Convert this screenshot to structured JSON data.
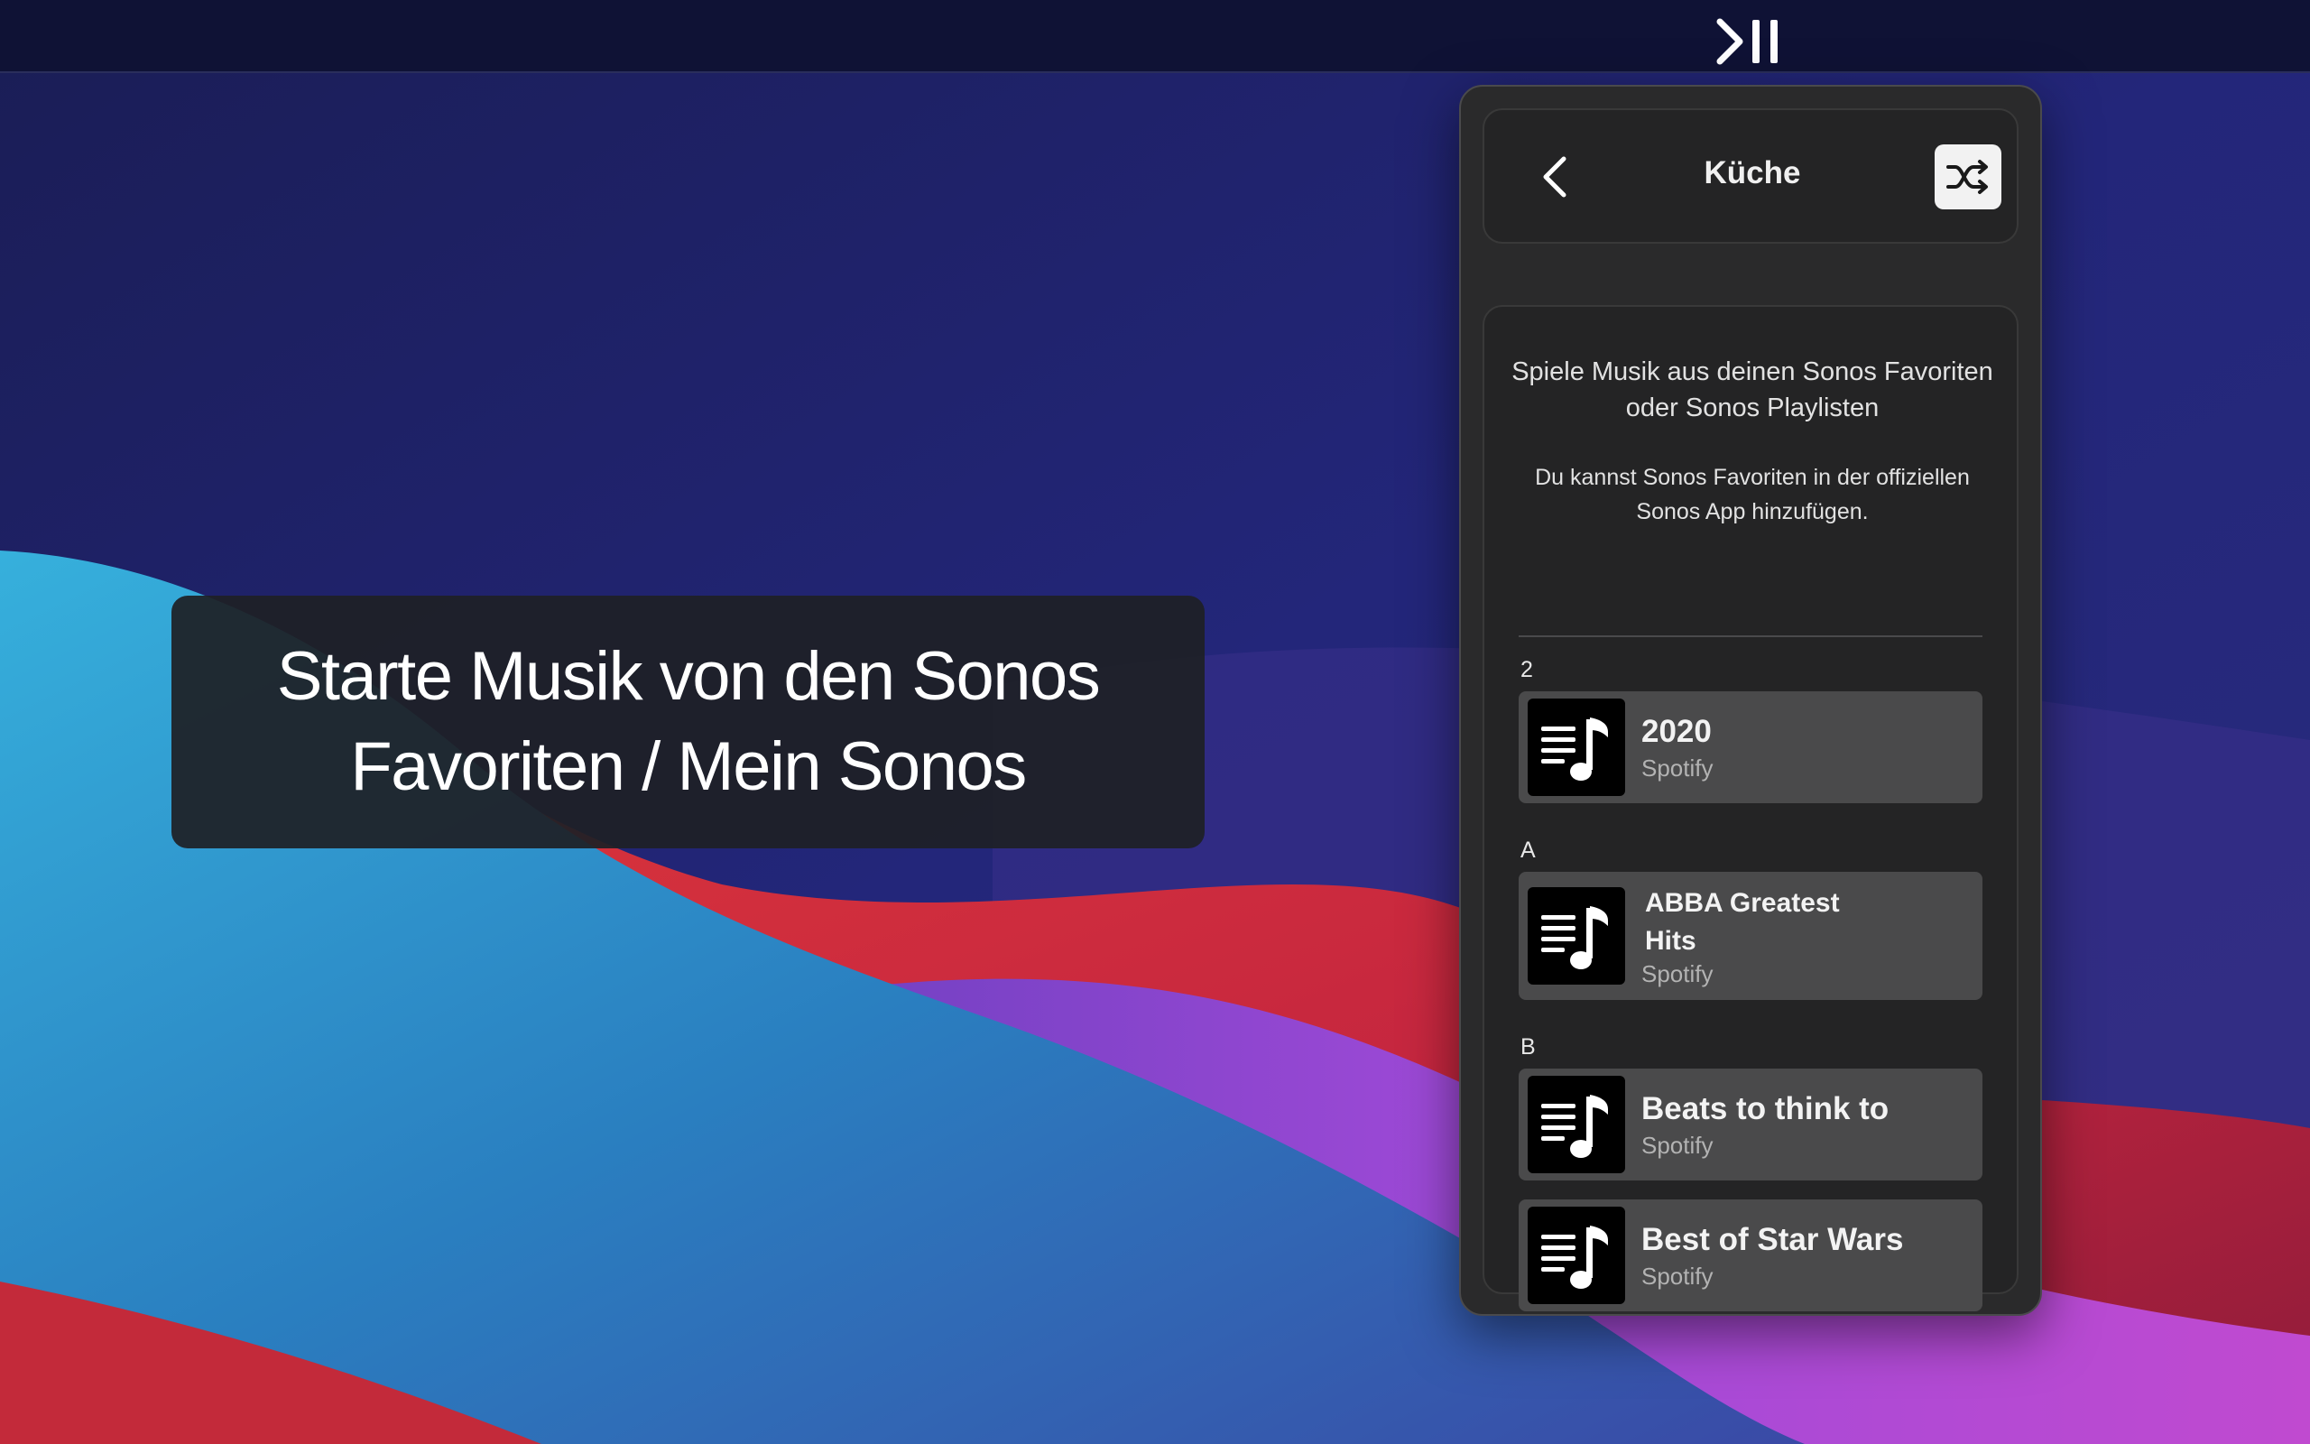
{
  "menubar": {
    "status_icon": "play-pause-icon"
  },
  "caption": {
    "line1": "Starte Musik von den Sonos",
    "line2": "Favoriten / Mein Sonos"
  },
  "popover": {
    "header": {
      "back_icon": "chevron-left-icon",
      "title": "Küche",
      "shuffle_icon": "shuffle-icon"
    },
    "info": {
      "main": "Spiele Musik aus deinen Sonos Favoriten oder Sonos Playlisten",
      "sub": "Du kannst Sonos Favoriten in der offiziellen Sonos App hinzufügen."
    },
    "sections": [
      {
        "letter": "2",
        "items": [
          {
            "title": "2020",
            "source": "Spotify",
            "icon": "playlist-music-icon"
          }
        ]
      },
      {
        "letter": "A",
        "items": [
          {
            "title": "ABBA Greatest Hits",
            "source": "Spotify",
            "icon": "playlist-music-icon"
          }
        ]
      },
      {
        "letter": "B",
        "items": [
          {
            "title": "Beats to think to",
            "source": "Spotify",
            "icon": "playlist-music-icon"
          },
          {
            "title": "Best of Star Wars",
            "source": "Spotify",
            "icon": "playlist-music-icon"
          }
        ]
      }
    ]
  },
  "colors": {
    "menubar": "#0f1235",
    "panel": "#2a2a2b",
    "card": "#242425",
    "item": "#4a4a4b",
    "wallpaper_top": "#1e2262",
    "wave_blue": "#2e9fcf",
    "wave_red": "#d3303e",
    "wave_purple": "#9a4ad6"
  }
}
